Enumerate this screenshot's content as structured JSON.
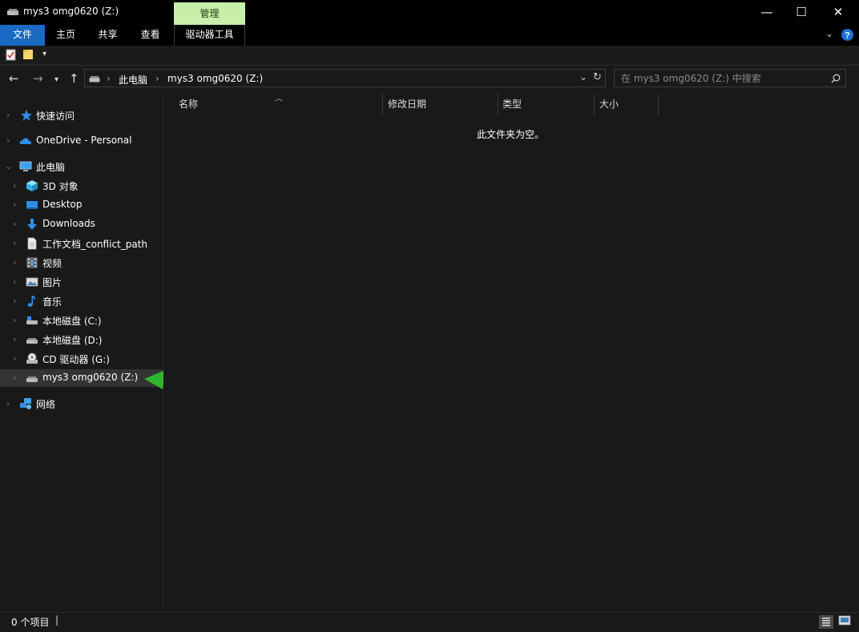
{
  "window": {
    "title": "mys3 omg0620 (Z:)",
    "manage_tab": "管理",
    "minimize": "—",
    "maximize": "☐",
    "close": "✕"
  },
  "ribbon": {
    "tabs": [
      {
        "label": "文件",
        "active": true
      },
      {
        "label": "主页"
      },
      {
        "label": "共享"
      },
      {
        "label": "查看"
      },
      {
        "label": "驱动器工具"
      }
    ]
  },
  "address": {
    "crumbs": [
      "此电脑",
      "mys3 omg0620 (Z:)"
    ]
  },
  "search": {
    "placeholder": "在 mys3 omg0620 (Z:) 中搜索"
  },
  "nav": {
    "items": [
      {
        "label": "快速访问",
        "icon": "star-icon",
        "level": 0
      },
      {
        "label": "OneDrive - Personal",
        "icon": "cloud-icon",
        "level": 0
      },
      {
        "label": "此电脑",
        "icon": "computer-icon",
        "level": 0,
        "expanded": true
      },
      {
        "label": "3D 对象",
        "icon": "cube-icon",
        "level": 1
      },
      {
        "label": "Desktop",
        "icon": "desktop-icon",
        "level": 1
      },
      {
        "label": "Downloads",
        "icon": "download-icon",
        "level": 1
      },
      {
        "label": "工作文档_conflict_path",
        "icon": "document-icon",
        "level": 1
      },
      {
        "label": "视频",
        "icon": "video-icon",
        "level": 1
      },
      {
        "label": "图片",
        "icon": "picture-icon",
        "level": 1
      },
      {
        "label": "音乐",
        "icon": "music-icon",
        "level": 1
      },
      {
        "label": "本地磁盘 (C:)",
        "icon": "drive-icon",
        "level": 1
      },
      {
        "label": "本地磁盘 (D:)",
        "icon": "drive-icon",
        "level": 1
      },
      {
        "label": "CD 驱动器 (G:)",
        "icon": "cd-drive-icon",
        "level": 1
      },
      {
        "label": "mys3 omg0620 (Z:)",
        "icon": "network-drive-icon",
        "level": 1,
        "selected": true
      },
      {
        "label": "网络",
        "icon": "network-icon",
        "level": 0
      }
    ]
  },
  "columns": [
    "名称",
    "修改日期",
    "类型",
    "大小"
  ],
  "empty_message": "此文件夹为空。",
  "status": {
    "items": "0 个项目"
  },
  "colors": {
    "accent": "#1a6ac3",
    "manage": "#c7efa9",
    "arrow": "#2db52d",
    "help": "#1a72d6"
  }
}
